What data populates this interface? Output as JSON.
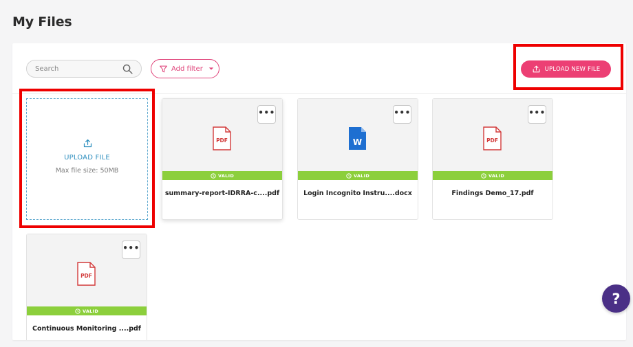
{
  "page": {
    "title": "My Files"
  },
  "search": {
    "placeholder": "Search"
  },
  "filter": {
    "label": "Add filter"
  },
  "upload_button": {
    "label": "UPLOAD NEW FILE"
  },
  "upload_tile": {
    "title": "UPLOAD FILE",
    "subtitle": "Max file size: 50MB"
  },
  "files": [
    {
      "name": "summary-report-IDRRA-c....pdf",
      "type": "pdf",
      "icon_label": "PDF",
      "status": "VALID",
      "menu": "•••"
    },
    {
      "name": "Login Incognito Instru....docx",
      "type": "docx",
      "icon_label": "W",
      "status": "VALID",
      "menu": "•••"
    },
    {
      "name": "Findings Demo_17.pdf",
      "type": "pdf",
      "icon_label": "PDF",
      "status": "VALID",
      "menu": "•••"
    },
    {
      "name": "Continuous Monitoring ....pdf",
      "type": "pdf",
      "icon_label": "PDF",
      "status": "VALID",
      "menu": "•••"
    }
  ],
  "help": {
    "label": "?"
  },
  "colors": {
    "accent_pink": "#ec3f74",
    "valid_green": "#8ccf3c",
    "upload_blue": "#2f8fbf",
    "pdf_red": "#d23a3a",
    "word_blue": "#1e6fd1",
    "help_purple": "#4a2f86",
    "highlight_red": "#ee0000"
  }
}
